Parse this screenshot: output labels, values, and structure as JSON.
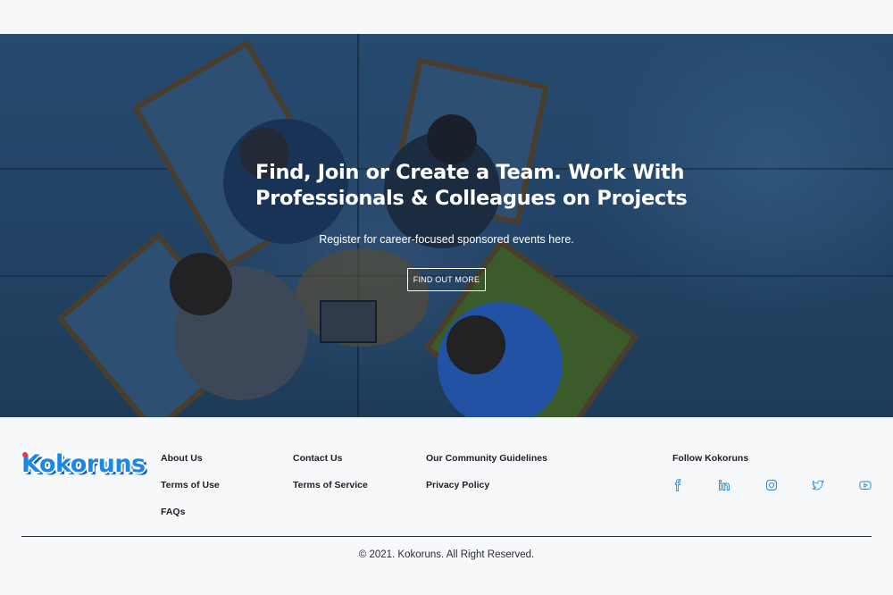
{
  "hero": {
    "title": "Find, Join or Create a Team. Work With Professionals & Colleagues on Projects",
    "subtitle": "Register for career-focused sponsored events here.",
    "cta_label": "FIND OUT MORE"
  },
  "footer": {
    "logo_text": "Kokoruns",
    "links": {
      "about": "About Us",
      "terms_use": "Terms of Use",
      "faqs": "FAQs",
      "contact": "Contact Us",
      "terms_service": "Terms of Service",
      "guidelines": "Our Community Guidelines",
      "privacy": "Privacy Policy"
    },
    "follow_title": "Follow Kokoruns",
    "social_icons": [
      "facebook-icon",
      "linkedin-icon",
      "instagram-icon",
      "twitter-icon",
      "youtube-icon"
    ],
    "copyright": "© 2021. Kokoruns. All Right Reserved."
  },
  "colors": {
    "brand_blue": "#1e87e6",
    "hero_overlay": "#2b5278",
    "text_dark": "#1d1f24",
    "background": "#f7f8f9"
  }
}
